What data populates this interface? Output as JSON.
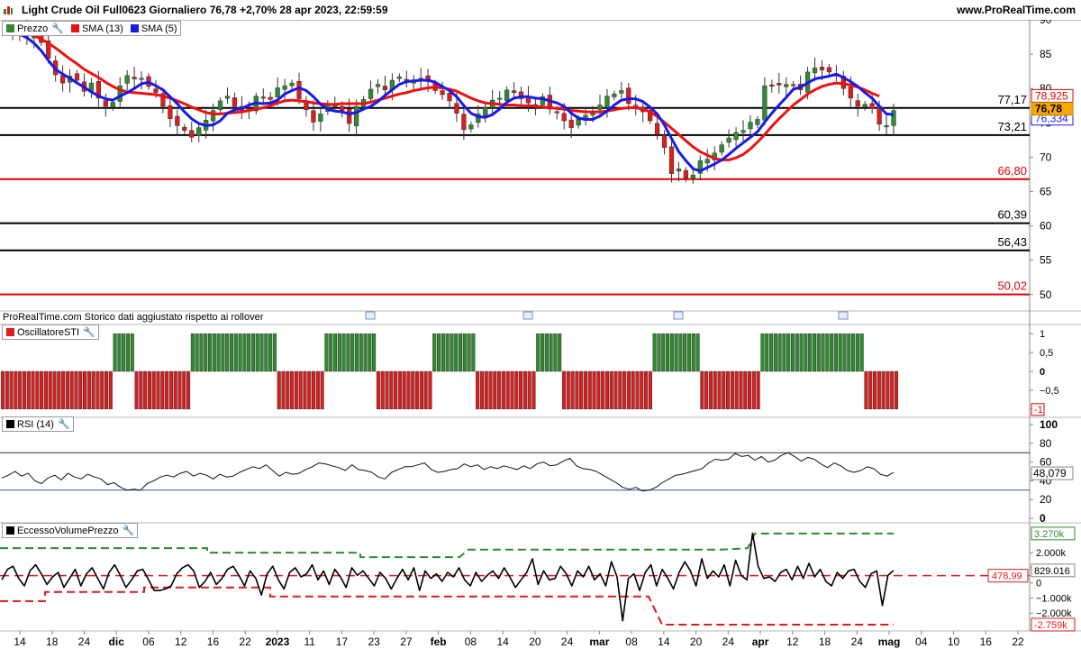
{
  "header": {
    "title": "Light Crude Oil Full0623 Giornaliero 76,78 +2,70% 28 apr 2023, 22:59:59",
    "site": "www.ProRealTime.com"
  },
  "legends": {
    "price": {
      "label": "Prezzo",
      "sma13": "SMA (13)",
      "sma5": "SMA (5)"
    },
    "sti": "OscillatoreSTI",
    "rsi": "RSI (14)",
    "volume": "EccessoVolumePrezzo"
  },
  "note": "ProRealTime.com Storico dati aggiustato rispetto ai rollover",
  "colors": {
    "up": "#2e8b2e",
    "down": "#dd1c1c",
    "sma13": "#ee1111",
    "sma5": "#1a1ae6"
  },
  "chart_data": [
    {
      "type": "candlestick",
      "ylim": [
        48,
        90
      ],
      "yticks": [
        90,
        85,
        80,
        75,
        70,
        65,
        60,
        55,
        50
      ],
      "xticks": [
        "14",
        "18",
        "24",
        "dic",
        "06",
        "12",
        "16",
        "22",
        "2023",
        "11",
        "17",
        "23",
        "27",
        "feb",
        "08",
        "14",
        "20",
        "24",
        "mar",
        "08",
        "14",
        "20",
        "24",
        "apr",
        "12",
        "18",
        "24",
        "mag",
        "04",
        "10",
        "16",
        "22"
      ],
      "last_price": "76,78",
      "sma13_value": "78,925",
      "sma5_value": "76,334",
      "levels": [
        {
          "value": 77.17,
          "label": "77,17",
          "color": "#000000"
        },
        {
          "value": 73.21,
          "label": "73,21",
          "color": "#000000"
        },
        {
          "value": 66.8,
          "label": "66,80",
          "color": "#dd0000"
        },
        {
          "value": 60.39,
          "label": "60,39",
          "color": "#000000"
        },
        {
          "value": 56.43,
          "label": "56,43",
          "color": "#000000"
        },
        {
          "value": 50.02,
          "label": "50,02",
          "color": "#dd0000"
        }
      ],
      "close": [
        88.2,
        87.8,
        88.4,
        87.6,
        87.9,
        86.7,
        84.4,
        82.0,
        80.8,
        81.8,
        81.2,
        79.6,
        80.8,
        78.6,
        77.4,
        78.0,
        80.4,
        81.9,
        81.4,
        81.5,
        80.3,
        79.4,
        77.4,
        75.6,
        74.6,
        73.9,
        72.9,
        74.3,
        75.4,
        76.8,
        78.2,
        78.9,
        77.4,
        76.8,
        77.1,
        78.9,
        78.6,
        78.4,
        80.1,
        80.4,
        80.8,
        78.5,
        76.9,
        75.1,
        76.3,
        77.8,
        77.4,
        76.8,
        74.9,
        77.4,
        78.4,
        79.9,
        80.6,
        79.8,
        81.2,
        81.7,
        80.9,
        81.2,
        81.5,
        81.0,
        79.7,
        79.1,
        78.2,
        76.4,
        74.0,
        74.7,
        76.3,
        77.2,
        78.3,
        78.6,
        79.8,
        79.4,
        78.5,
        77.9,
        77.6,
        78.8,
        77.0,
        76.5,
        75.3,
        74.3,
        75.6,
        76.1,
        76.7,
        77.6,
        78.9,
        79.2,
        79.7,
        77.8,
        77.3,
        76.6,
        75.3,
        73.3,
        71.4,
        67.6,
        68.3,
        66.9,
        67.4,
        69.5,
        69.7,
        70.6,
        71.8,
        72.8,
        73.6,
        73.9,
        75.1,
        75.5,
        80.4,
        80.4,
        80.5,
        80.6,
        80.4,
        79.8,
        82.4,
        83.0,
        82.7,
        82.4,
        81.8,
        80.0,
        78.6,
        77.4,
        77.7,
        77.1,
        74.8,
        74.6,
        76.8
      ],
      "sma5": [
        88.3,
        88.1,
        87.9,
        87.4,
        86.6,
        85.5,
        84.1,
        82.8,
        82.1,
        81.5,
        80.8,
        80.2,
        79.5,
        78.9,
        78.5,
        78.3,
        78.9,
        79.4,
        80.0,
        80.7,
        80.9,
        80.4,
        79.8,
        78.8,
        77.8,
        76.6,
        75.6,
        74.9,
        74.6,
        74.7,
        75.3,
        76.4,
        76.9,
        77.1,
        77.6,
        77.9,
        77.8,
        77.9,
        78.3,
        79.2,
        79.7,
        80.1,
        79.7,
        78.8,
        77.7,
        77.0,
        76.7,
        76.6,
        76.3,
        76.5,
        77.0,
        77.4,
        78.1,
        79.0,
        79.8,
        80.6,
        81.0,
        81.1,
        81.2,
        81.2,
        80.9,
        80.3,
        79.7,
        78.8,
        77.5,
        76.4,
        75.9,
        75.8,
        76.2,
        77.0,
        78.0,
        78.6,
        78.8,
        78.8,
        78.6,
        78.5,
        78.2,
        77.9,
        77.4,
        76.4,
        75.7,
        75.5,
        75.5,
        76.0,
        76.7,
        77.6,
        78.3,
        78.5,
        78.5,
        78.1,
        77.3,
        76.3,
        74.7,
        72.7,
        70.8,
        69.5,
        68.3,
        68.0,
        68.5,
        69.0,
        69.6,
        70.4,
        71.3,
        72.1,
        72.9,
        73.7,
        75.1,
        76.4,
        77.6,
        78.7,
        79.9,
        80.2,
        80.8,
        81.4,
        81.6,
        81.8,
        82.1,
        81.6,
        81.0,
        80.3,
        79.4,
        78.6,
        77.4,
        76.3,
        76.2
      ],
      "sma13": [
        88.6,
        88.6,
        88.4,
        88.1,
        87.7,
        87.2,
        86.6,
        85.9,
        85.1,
        84.3,
        83.6,
        82.8,
        82.2,
        81.6,
        80.9,
        80.3,
        79.8,
        79.5,
        79.4,
        79.3,
        79.2,
        79.1,
        78.9,
        78.6,
        78.2,
        77.8,
        77.3,
        76.9,
        76.5,
        76.3,
        76.3,
        76.4,
        76.5,
        76.6,
        76.8,
        77.0,
        77.2,
        77.5,
        77.9,
        78.2,
        78.3,
        78.2,
        78.1,
        77.9,
        77.8,
        77.7,
        77.7,
        77.8,
        77.8,
        77.8,
        77.8,
        78.0,
        78.3,
        78.6,
        78.9,
        79.2,
        79.4,
        79.7,
        79.9,
        80.1,
        80.2,
        80.1,
        79.9,
        79.6,
        79.1,
        78.6,
        78.2,
        77.9,
        77.8,
        77.7,
        77.6,
        77.6,
        77.5,
        77.5,
        77.4,
        77.3,
        77.2,
        77.1,
        77.0,
        76.8,
        76.7,
        76.6,
        76.6,
        76.6,
        76.7,
        76.9,
        77.1,
        77.2,
        77.2,
        77.0,
        76.6,
        75.9,
        75.1,
        74.2,
        73.3,
        72.4,
        71.5,
        70.8,
        70.3,
        69.8,
        69.6,
        69.6,
        69.9,
        70.4,
        71.2,
        72.2,
        73.3,
        74.5,
        75.6,
        76.6,
        77.6,
        78.4,
        79.2,
        79.8,
        80.3,
        80.6,
        80.8,
        80.7,
        80.5,
        80.2,
        79.8,
        79.3,
        78.9
      ]
    },
    {
      "type": "bar",
      "name": "OscillatoreSTI",
      "ylim": [
        -1.1,
        1.1
      ],
      "yticks": [
        "1",
        "0,5",
        "0",
        "−0,5",
        "-1"
      ],
      "values": [
        -1,
        -1,
        -1,
        -1,
        -1,
        -1,
        -1,
        -1,
        -1,
        -1,
        -1,
        -1,
        -1,
        -1,
        -1,
        -1,
        -1,
        -1,
        -1,
        -1,
        -1,
        -1,
        -1,
        -1,
        -1,
        -1,
        1,
        1,
        1,
        1,
        1,
        -1,
        -1,
        -1,
        -1,
        -1,
        -1,
        -1,
        -1,
        -1,
        -1,
        -1,
        -1,
        -1,
        1,
        1,
        1,
        1,
        1,
        1,
        1,
        1,
        1,
        1,
        1,
        1,
        1,
        1,
        1,
        1,
        1,
        1,
        1,
        1,
        -1,
        -1,
        -1,
        -1,
        -1,
        -1,
        -1,
        -1,
        -1,
        -1,
        -1,
        1,
        1,
        1,
        1,
        1,
        1,
        1,
        1,
        1,
        1,
        1,
        1,
        -1,
        -1,
        -1,
        -1,
        -1,
        -1,
        -1,
        -1,
        -1,
        -1,
        -1,
        -1,
        -1,
        1,
        1,
        1,
        1,
        1,
        1,
        1,
        1,
        1,
        1,
        -1,
        -1,
        -1,
        -1,
        -1,
        -1,
        -1,
        -1,
        -1,
        -1,
        -1,
        -1,
        -1,
        -1,
        1,
        1,
        1,
        1,
        1,
        1,
        -1,
        -1,
        -1,
        -1,
        -1,
        -1,
        -1,
        -1,
        -1,
        -1,
        -1,
        -1,
        -1,
        -1,
        -1,
        -1,
        -1,
        -1,
        -1,
        -1,
        -1,
        1,
        1,
        1,
        1,
        1,
        1,
        1,
        1,
        1,
        1,
        1,
        -1,
        -1,
        -1,
        -1,
        -1,
        -1,
        -1,
        -1,
        -1,
        -1,
        -1,
        -1,
        -1,
        -1,
        1,
        1,
        1,
        1,
        1,
        1,
        1,
        1,
        1,
        1,
        1,
        1,
        1,
        1,
        1,
        1,
        1,
        1,
        1,
        1,
        1,
        1,
        1,
        1,
        -1,
        -1,
        -1,
        -1,
        -1,
        -1,
        -1,
        -1
      ]
    },
    {
      "type": "line",
      "name": "RSI (14)",
      "ylim": [
        0,
        100
      ],
      "yticks": [
        100,
        80,
        60,
        40,
        20,
        0
      ],
      "bands": [
        70,
        30
      ],
      "last_value": "48,079",
      "values": [
        43,
        46,
        50,
        45,
        48,
        40,
        37,
        43,
        46,
        41,
        48,
        44,
        42,
        47,
        44,
        42,
        36,
        38,
        33,
        30,
        31,
        30,
        37,
        40,
        44,
        46,
        44,
        48,
        50,
        45,
        48,
        46,
        42,
        47,
        44,
        45,
        49,
        52,
        55,
        53,
        57,
        51,
        45,
        49,
        47,
        48,
        52,
        55,
        59,
        58,
        56,
        54,
        51,
        57,
        52,
        51,
        49,
        44,
        42,
        49,
        52,
        55,
        55,
        57,
        59,
        52,
        49,
        50,
        52,
        53,
        58,
        55,
        57,
        52,
        55,
        53,
        56,
        54,
        52,
        56,
        53,
        58,
        60,
        56,
        57,
        61,
        64,
        56,
        53,
        52,
        50,
        46,
        42,
        38,
        33,
        31,
        33,
        29,
        30,
        33,
        38,
        42,
        46,
        47,
        49,
        51,
        53,
        59,
        63,
        62,
        63,
        69,
        66,
        67,
        62,
        66,
        60,
        62,
        67,
        70,
        66,
        61,
        65,
        63,
        58,
        54,
        59,
        56,
        51,
        49,
        51,
        55,
        53,
        47,
        45,
        49
      ]
    },
    {
      "type": "line",
      "name": "EccessoVolumePrezzo",
      "ylim": [
        -3000,
        3500
      ],
      "yticks": [
        "3.270k",
        "2.000k",
        "1.000k",
        "0",
        "−1.000k",
        "−2.000k",
        "-2.759k"
      ],
      "last_value": "829.016",
      "threshold_label": "478,99",
      "upper_band_label": "3.270k",
      "lower_band_label": "-2.759k",
      "values": [
        200,
        900,
        1100,
        300,
        -200,
        800,
        1200,
        600,
        -100,
        400,
        700,
        -300,
        300,
        900,
        -200,
        600,
        1000,
        300,
        -400,
        700,
        1200,
        500,
        -300,
        200,
        800,
        900,
        200,
        -500,
        -500,
        -400,
        -200,
        600,
        1000,
        1200,
        800,
        -300,
        100,
        700,
        -100,
        300,
        900,
        1100,
        500,
        -200,
        800,
        300,
        -800,
        600,
        1100,
        200,
        -400,
        700,
        1000,
        400,
        600,
        1200,
        200,
        800,
        -100,
        900,
        400,
        -300,
        1000,
        500,
        800,
        300,
        -200,
        700,
        300,
        -400,
        300,
        900,
        200,
        1000,
        -500,
        800,
        300,
        600,
        100,
        700,
        400,
        1000,
        200,
        -200,
        700,
        100,
        500,
        800,
        300,
        1000,
        400,
        -300,
        200,
        700,
        1600,
        -100,
        800,
        200,
        300,
        1100,
        600,
        -200,
        800,
        400,
        1100,
        200,
        600,
        -200,
        1400,
        400,
        -2500,
        300,
        600,
        -500,
        700,
        1200,
        -200,
        900,
        300,
        -400,
        700,
        1400,
        800,
        -200,
        1600,
        300,
        800,
        400,
        1200,
        -200,
        1500,
        500,
        200,
        3300,
        1100,
        300,
        400,
        100,
        700,
        900,
        200,
        1100,
        300,
        1300,
        400,
        900,
        100,
        -200,
        700,
        300,
        800,
        900,
        100,
        -300,
        600,
        800,
        -1500,
        500,
        829
      ]
    }
  ]
}
